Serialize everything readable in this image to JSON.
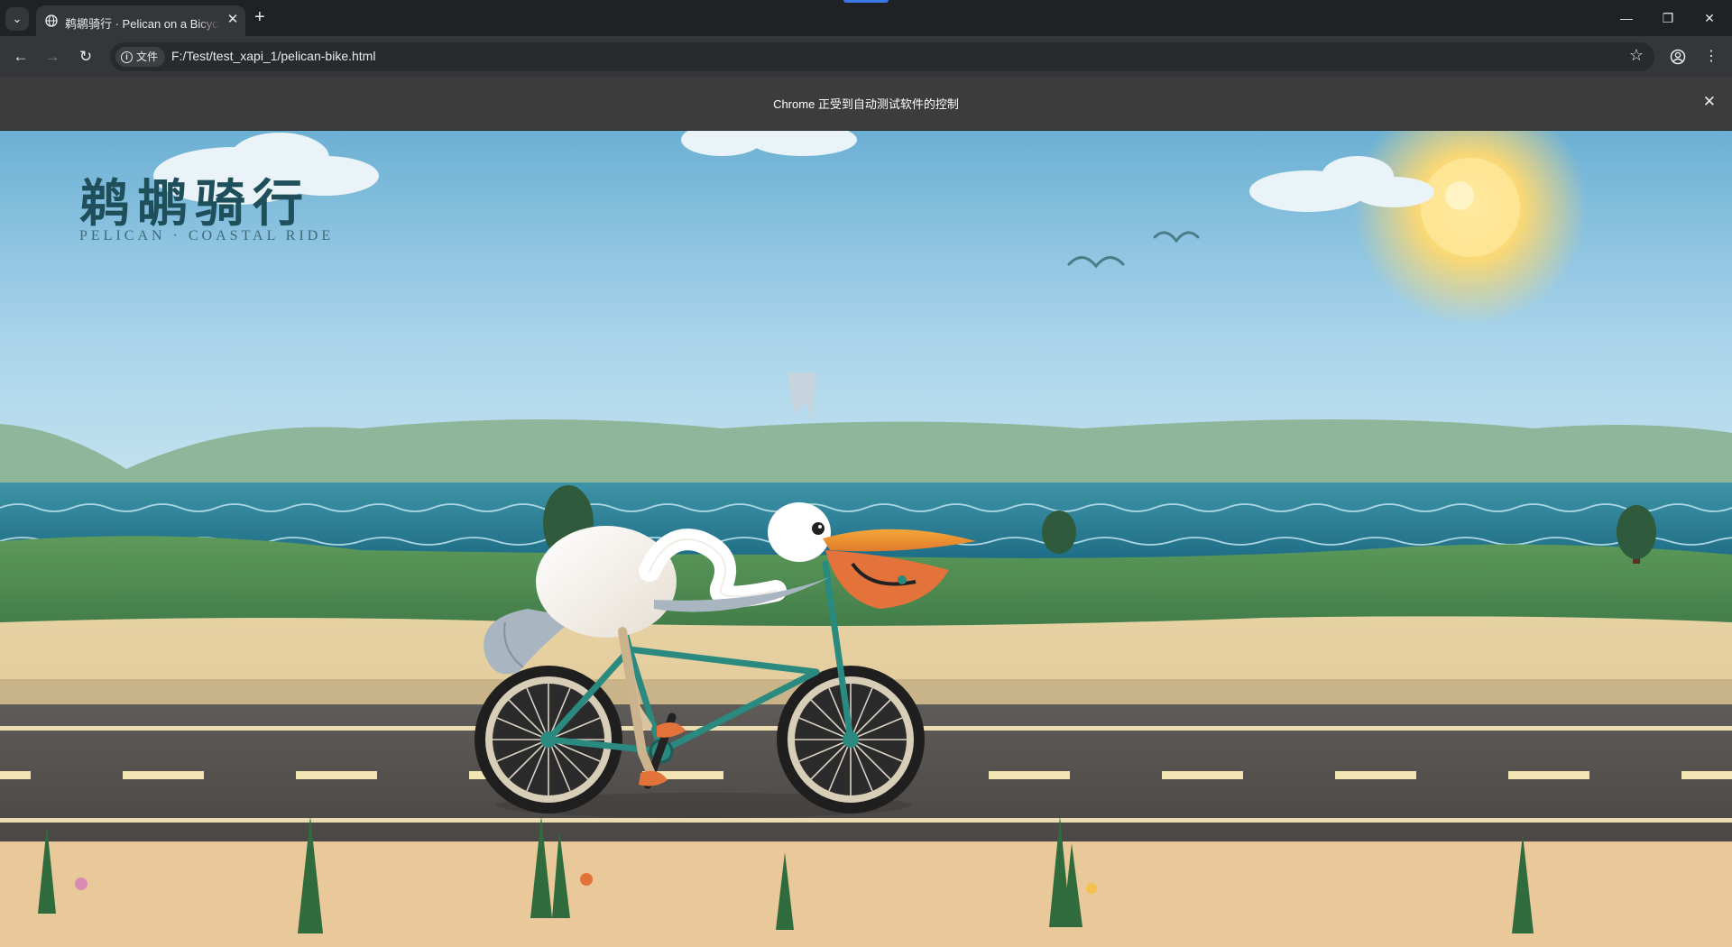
{
  "browser": {
    "tab": {
      "title": "鹈鹕骑行 · Pelican on a Bicycle",
      "favicon": "globe-icon"
    },
    "address": {
      "chip_label": "文件",
      "url": "F:/Test/test_xapi_1/pelican-bike.html"
    },
    "infobar": {
      "message": "Chrome 正受到自动测试软件的控制"
    },
    "colors": {
      "frame": "#202124",
      "toolbar": "#35363a",
      "infobar": "#3c3c3c"
    }
  },
  "page": {
    "title_cn": "鹈鹕骑行",
    "subtitle_en": "PELICAN · COASTAL RIDE"
  }
}
